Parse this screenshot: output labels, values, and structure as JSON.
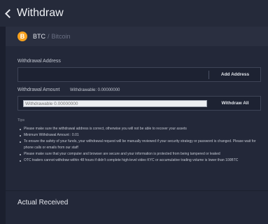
{
  "header": {
    "title": "Withdraw",
    "back_icon": "chevron-left-icon"
  },
  "coin": {
    "icon_letter": "B",
    "icon_color": "#f7a11e",
    "symbol": "BTC",
    "separator": "/",
    "name": "Bitcoin"
  },
  "address": {
    "label": "Withdrawal Address",
    "value": "",
    "add_button": "Add Address"
  },
  "amount": {
    "label": "Withdrawal Amount",
    "withdrawable": "Withdrawable: 0.00000000",
    "placeholder": "Withdrawable 0.00000000",
    "withdraw_all_button": "Withdraw All"
  },
  "tips": {
    "label": "Tips",
    "items": [
      "Please make sure the withdrawal address is correct, otherwise you will not be able to recover your assets",
      "Minimum Withdrawal Amount : 0.01",
      "To ensure the safety of your funds, your withdrawal request will be manually reviewed if your security strategy or password is changed. Please wait for phone calls or emails from our staff",
      "Please make sure that your computer and browser are secure and your information is protected from being tampered or leaked",
      "OTC traders cannot withdraw within 48 hours if didn't complete high-level video KYC or accumulative trading volume is lower than 100BTC"
    ]
  },
  "actual_received": {
    "label": "Actual Received"
  }
}
